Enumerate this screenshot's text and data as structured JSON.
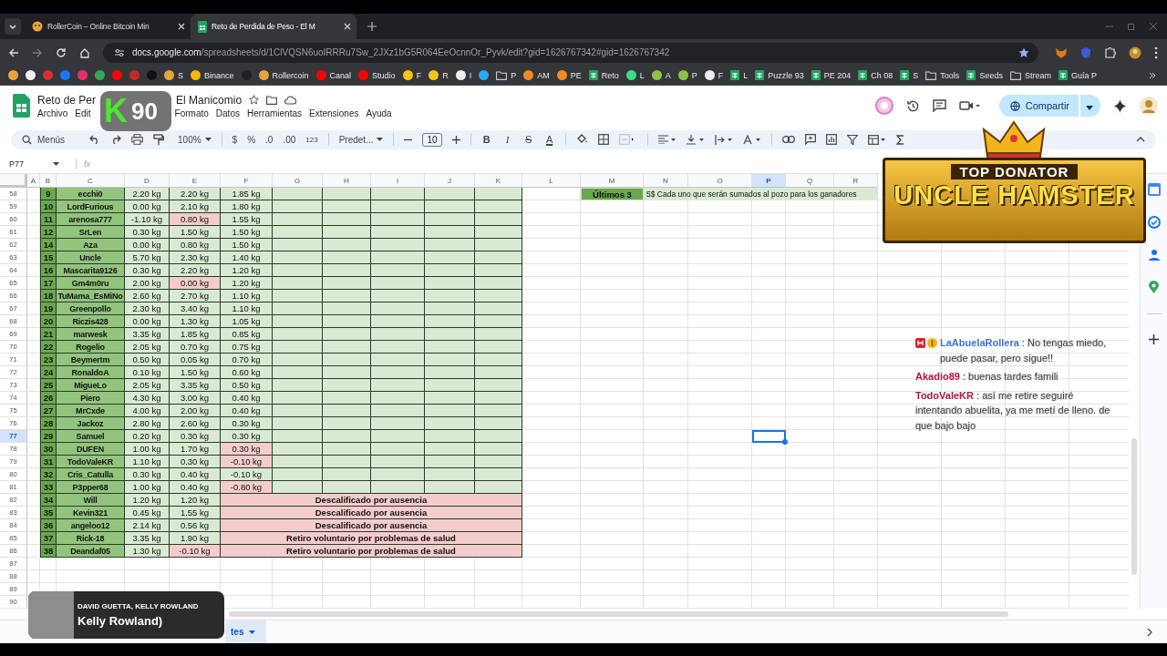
{
  "browser": {
    "tabs": [
      {
        "title": "RollerCoin – Online Bitcoin Min",
        "selected": false,
        "kind": "game"
      },
      {
        "title": "Reto de Perdida de Peso - El M",
        "selected": true,
        "kind": "sheet"
      }
    ],
    "url_host": "docs.google.com",
    "url_path": "/spreadsheets/d/1ClVQSN6uoIRRRu7Sw_2JXz1bG5R064EeOcnnOr_Pyvk/edit?gid=1626767342#gid=1626767342",
    "bookmarks": [
      {
        "kind": "dot",
        "color": "#e8a33a"
      },
      {
        "kind": "dot",
        "color": "#f2f2f2"
      },
      {
        "kind": "dot",
        "color": "#d32f2f"
      },
      {
        "kind": "dot",
        "color": "#1877f2"
      },
      {
        "kind": "dot",
        "color": "#e1306c"
      },
      {
        "kind": "dot",
        "color": "#34a853"
      },
      {
        "kind": "dot",
        "color": "#ff0000"
      },
      {
        "kind": "dot",
        "color": "#c62828"
      },
      {
        "kind": "dot",
        "color": "#111111"
      },
      {
        "kind": "dot",
        "color": "#e8a33a",
        "label": "S"
      },
      {
        "kind": "dot",
        "color": "#f0b90b",
        "label": "Binance"
      },
      {
        "kind": "dot",
        "color": "#222222"
      },
      {
        "kind": "dot",
        "color": "#e8a33a",
        "label": "Rollercoin"
      },
      {
        "kind": "dot",
        "color": "#ff0000",
        "label": "Canal"
      },
      {
        "kind": "dot",
        "color": "#ff0000",
        "label": "Studio"
      },
      {
        "kind": "dot",
        "color": "#f5c518",
        "label": "F"
      },
      {
        "kind": "dot",
        "color": "#f5c518",
        "label": "R"
      },
      {
        "kind": "dot",
        "color": "#eeeeee",
        "label": "I"
      },
      {
        "kind": "dot",
        "color": "#29a9eb"
      },
      {
        "kind": "folder",
        "label": "P"
      },
      {
        "kind": "dot",
        "color": "#f08a24",
        "label": "AM"
      },
      {
        "kind": "dot",
        "color": "#f08a24",
        "label": "PE"
      },
      {
        "kind": "sheet",
        "label": "Reto"
      },
      {
        "kind": "dot",
        "color": "#3ddc84",
        "label": "L"
      },
      {
        "kind": "dot",
        "color": "#8bc34a",
        "label": "A"
      },
      {
        "kind": "dot",
        "color": "#8bc34a",
        "label": "P"
      },
      {
        "kind": "dot",
        "color": "#eeeeee",
        "label": "F"
      },
      {
        "kind": "sheet",
        "label": "L"
      },
      {
        "kind": "sheet",
        "label": "Puzzle 93"
      },
      {
        "kind": "sheet",
        "label": "PE 204"
      },
      {
        "kind": "sheet",
        "label": "Ch 08"
      },
      {
        "kind": "sheet",
        "label": "S"
      },
      {
        "kind": "folder",
        "label": "Tools"
      },
      {
        "kind": "sheet",
        "label": "Seeds"
      },
      {
        "kind": "folder",
        "label": "Stream"
      },
      {
        "kind": "sheet",
        "label": "Guía P"
      }
    ]
  },
  "doc": {
    "title_start": "Reto de Per",
    "title_end": "El Manicomio",
    "menu": [
      "Archivo",
      "Edit"
    ],
    "menu_rest": [
      "Formato",
      "Datos",
      "Herramientas",
      "Extensiones",
      "Ayuda"
    ],
    "share": "Compartir"
  },
  "toolbar": {
    "search": "Menús",
    "zoom": "100%",
    "currency": "$",
    "percent": "%",
    "dec_less": ".0",
    "dec_more": ".00",
    "number_format": "123",
    "font": "Predet...",
    "font_size": "10",
    "format_buttons": [
      {
        "kind": "bold",
        "label": "B"
      },
      {
        "kind": "italic",
        "label": "I"
      },
      {
        "kind": "strike",
        "label": "S"
      },
      {
        "kind": "color",
        "label": "A"
      }
    ]
  },
  "formula_bar": {
    "cell": "P77",
    "fx": "fx"
  },
  "columns": [
    {
      "label": "A",
      "selected": false
    },
    {
      "label": "B",
      "selected": false
    },
    {
      "label": "C",
      "selected": false
    },
    {
      "label": "D",
      "selected": false
    },
    {
      "label": "E",
      "selected": false
    },
    {
      "label": "F",
      "selected": false
    },
    {
      "label": "G",
      "selected": false
    },
    {
      "label": "H",
      "selected": false
    },
    {
      "label": "I",
      "selected": false
    },
    {
      "label": "J",
      "selected": false
    },
    {
      "label": "K",
      "selected": false
    },
    {
      "label": "L",
      "selected": false
    },
    {
      "label": "M",
      "selected": false
    },
    {
      "label": "N",
      "selected": false
    },
    {
      "label": "O",
      "selected": false
    },
    {
      "label": "P",
      "selected": true
    },
    {
      "label": "Q",
      "selected": false
    },
    {
      "label": "R",
      "selected": false
    }
  ],
  "side_note": {
    "label": "Últimos 3",
    "text": "5$ Cada uno que serán sumados al pozo para los ganadores"
  },
  "rows": [
    {
      "row": "58",
      "selected": false,
      "kind": "result",
      "num": "9",
      "name": "ecchi0",
      "d": "2.20 kg",
      "e": "2.20 kg",
      "e_alert": false,
      "f": "1.85 kg",
      "f_alert": false
    },
    {
      "row": "59",
      "selected": false,
      "kind": "result",
      "num": "10",
      "name": "LordFurious",
      "d": "0.00 kg",
      "e": "2.10 kg",
      "e_alert": false,
      "f": "1.80 kg",
      "f_alert": false
    },
    {
      "row": "60",
      "selected": false,
      "kind": "result",
      "num": "11",
      "name": "arenosa777",
      "d": "-1.10 kg",
      "e": "0.80 kg",
      "e_alert": true,
      "f": "1.55 kg",
      "f_alert": false
    },
    {
      "row": "61",
      "selected": false,
      "kind": "result",
      "num": "12",
      "name": "SrLen",
      "d": "0.30 kg",
      "e": "1.50 kg",
      "e_alert": false,
      "f": "1.50 kg",
      "f_alert": false
    },
    {
      "row": "62",
      "selected": false,
      "kind": "result",
      "num": "14",
      "name": "Aza",
      "d": "0.00 kg",
      "e": "0.80 kg",
      "e_alert": false,
      "f": "1.50 kg",
      "f_alert": false
    },
    {
      "row": "63",
      "selected": false,
      "kind": "result",
      "num": "15",
      "name": "Uncle",
      "d": "5.70 kg",
      "e": "2.30 kg",
      "e_alert": false,
      "f": "1.40 kg",
      "f_alert": false
    },
    {
      "row": "64",
      "selected": false,
      "kind": "result",
      "num": "16",
      "name": "Mascarita9126",
      "d": "0.30 kg",
      "e": "2.20 kg",
      "e_alert": false,
      "f": "1.20 kg",
      "f_alert": false
    },
    {
      "row": "65",
      "selected": false,
      "kind": "result",
      "num": "17",
      "name": "Gm4m0ru",
      "d": "2.00 kg",
      "e": "0.00 kg",
      "e_alert": true,
      "f": "1.20 kg",
      "f_alert": false
    },
    {
      "row": "66",
      "selected": false,
      "kind": "result",
      "num": "18",
      "name": "TuMama_EsMiNo",
      "d": "2.60 kg",
      "e": "2.70 kg",
      "e_alert": false,
      "f": "1.10 kg",
      "f_alert": false
    },
    {
      "row": "67",
      "selected": false,
      "kind": "result",
      "num": "19",
      "name": "Greenpollo",
      "d": "2.30 kg",
      "e": "3.40 kg",
      "e_alert": false,
      "f": "1.10 kg",
      "f_alert": false
    },
    {
      "row": "68",
      "selected": false,
      "kind": "result",
      "num": "20",
      "name": "Riczis428",
      "d": "0.00 kg",
      "e": "1.30 kg",
      "e_alert": false,
      "f": "1.05 kg",
      "f_alert": false
    },
    {
      "row": "69",
      "selected": false,
      "kind": "result",
      "num": "21",
      "name": "marwesk",
      "d": "3.35 kg",
      "e": "1.85 kg",
      "e_alert": false,
      "f": "0.85 kg",
      "f_alert": false
    },
    {
      "row": "70",
      "selected": false,
      "kind": "result",
      "num": "22",
      "name": "Rogelio",
      "d": "2.05 kg",
      "e": "0.70 kg",
      "e_alert": false,
      "f": "0.75 kg",
      "f_alert": false
    },
    {
      "row": "71",
      "selected": false,
      "kind": "result",
      "num": "23",
      "name": "Beymertm",
      "d": "0.50 kg",
      "e": "0.05 kg",
      "e_alert": false,
      "f": "0.70 kg",
      "f_alert": false
    },
    {
      "row": "72",
      "selected": false,
      "kind": "result",
      "num": "24",
      "name": "RonaldoA",
      "d": "0.10 kg",
      "e": "1.50 kg",
      "e_alert": false,
      "f": "0.60 kg",
      "f_alert": false
    },
    {
      "row": "73",
      "selected": false,
      "kind": "result",
      "num": "25",
      "name": "MigueLo",
      "d": "2.05 kg",
      "e": "3.35 kg",
      "e_alert": false,
      "f": "0.50 kg",
      "f_alert": false
    },
    {
      "row": "74",
      "selected": false,
      "kind": "result",
      "num": "26",
      "name": "Piero",
      "d": "4.30 kg",
      "e": "3.00 kg",
      "e_alert": false,
      "f": "0.40 kg",
      "f_alert": false
    },
    {
      "row": "75",
      "selected": false,
      "kind": "result",
      "num": "27",
      "name": "MrCxde",
      "d": "4.00 kg",
      "e": "2.00 kg",
      "e_alert": false,
      "f": "0.40 kg",
      "f_alert": false
    },
    {
      "row": "76",
      "selected": false,
      "kind": "result",
      "num": "28",
      "name": "Jackoz",
      "d": "2.80 kg",
      "e": "2.60 kg",
      "e_alert": false,
      "f": "0.30 kg",
      "f_alert": false
    },
    {
      "row": "77",
      "selected": true,
      "kind": "result",
      "num": "29",
      "name": "Samuel",
      "d": "0.20 kg",
      "e": "0.30 kg",
      "e_alert": false,
      "f": "0.30 kg",
      "f_alert": false
    },
    {
      "row": "78",
      "selected": false,
      "kind": "result",
      "num": "30",
      "name": "DUFEN",
      "d": "1.00 kg",
      "e": "1.70 kg",
      "e_alert": false,
      "f": "0.30 kg",
      "f_alert": true
    },
    {
      "row": "79",
      "selected": false,
      "kind": "result",
      "num": "31",
      "name": "TodoValeKR",
      "d": "1.10 kg",
      "e": "0.30 kg",
      "e_alert": false,
      "f": "-0.10 kg",
      "f_alert": true
    },
    {
      "row": "80",
      "selected": false,
      "kind": "result",
      "num": "32",
      "name": "Cris_Catulla",
      "d": "0.30 kg",
      "e": "0.40 kg",
      "e_alert": false,
      "f": "-0.10 kg",
      "f_alert": false
    },
    {
      "row": "81",
      "selected": false,
      "kind": "result",
      "num": "33",
      "name": "P3pper68",
      "d": "1.00 kg",
      "e": "0.40 kg",
      "e_alert": false,
      "f": "-0.80 kg",
      "f_alert": true
    },
    {
      "row": "82",
      "selected": false,
      "kind": "note",
      "num": "34",
      "name": "Will",
      "d": "1.20 kg",
      "e": "1.20 kg",
      "e_alert": false,
      "note": "Descalificado por ausencia"
    },
    {
      "row": "83",
      "selected": false,
      "kind": "note",
      "num": "35",
      "name": "Kevin321",
      "d": "0.45 kg",
      "e": "1.55 kg",
      "e_alert": false,
      "note": "Descalificado por ausencia"
    },
    {
      "row": "84",
      "selected": false,
      "kind": "note",
      "num": "36",
      "name": "angeloo12",
      "d": "2.14 kg",
      "e": "0.56 kg",
      "e_alert": false,
      "note": "Descalificado por ausencia"
    },
    {
      "row": "85",
      "selected": false,
      "kind": "note",
      "num": "37",
      "name": "Rick-18",
      "d": "3.35 kg",
      "e": "1.90 kg",
      "e_alert": false,
      "note": "Retiro voluntario por problemas de salud"
    },
    {
      "row": "86",
      "selected": false,
      "kind": "note",
      "num": "38",
      "name": "Deandaf05",
      "d": "1.30 kg",
      "e": "-0.10 kg",
      "e_alert": true,
      "note": "Retiro voluntario por problemas de salud"
    }
  ],
  "empty_rows": [
    {
      "row": "87",
      "selected": false
    },
    {
      "row": "88",
      "selected": false
    },
    {
      "row": "89",
      "selected": false
    },
    {
      "row": "90",
      "selected": false
    }
  ],
  "sheet_tab": {
    "label": "tes",
    "selected": true
  },
  "overlays": {
    "badge": {
      "letter": "K",
      "value": "90"
    },
    "donator": {
      "title": "TOP DONATOR",
      "name": "UNCLE HAMSTER"
    },
    "chat": [
      {
        "user": "LaAbuelaRollera",
        "color": "#3f6fd8",
        "badges": true,
        "text": ": No tengas miedo, puede pasar, pero sigue!!"
      },
      {
        "user": "Akadio89",
        "color": "#b3123f",
        "badges": false,
        "text": ": buenas tardes famili"
      },
      {
        "user": "TodoValeKR",
        "color": "#b3123f",
        "badges": false,
        "text": ": así me retire seguiré intentando abuelita, ya me metí de lleno. de que bajo bajo"
      }
    ],
    "music": {
      "artist": "DAVID GUETTA, KELLY ROWLAND",
      "title": "Kelly Rowland)"
    }
  }
}
